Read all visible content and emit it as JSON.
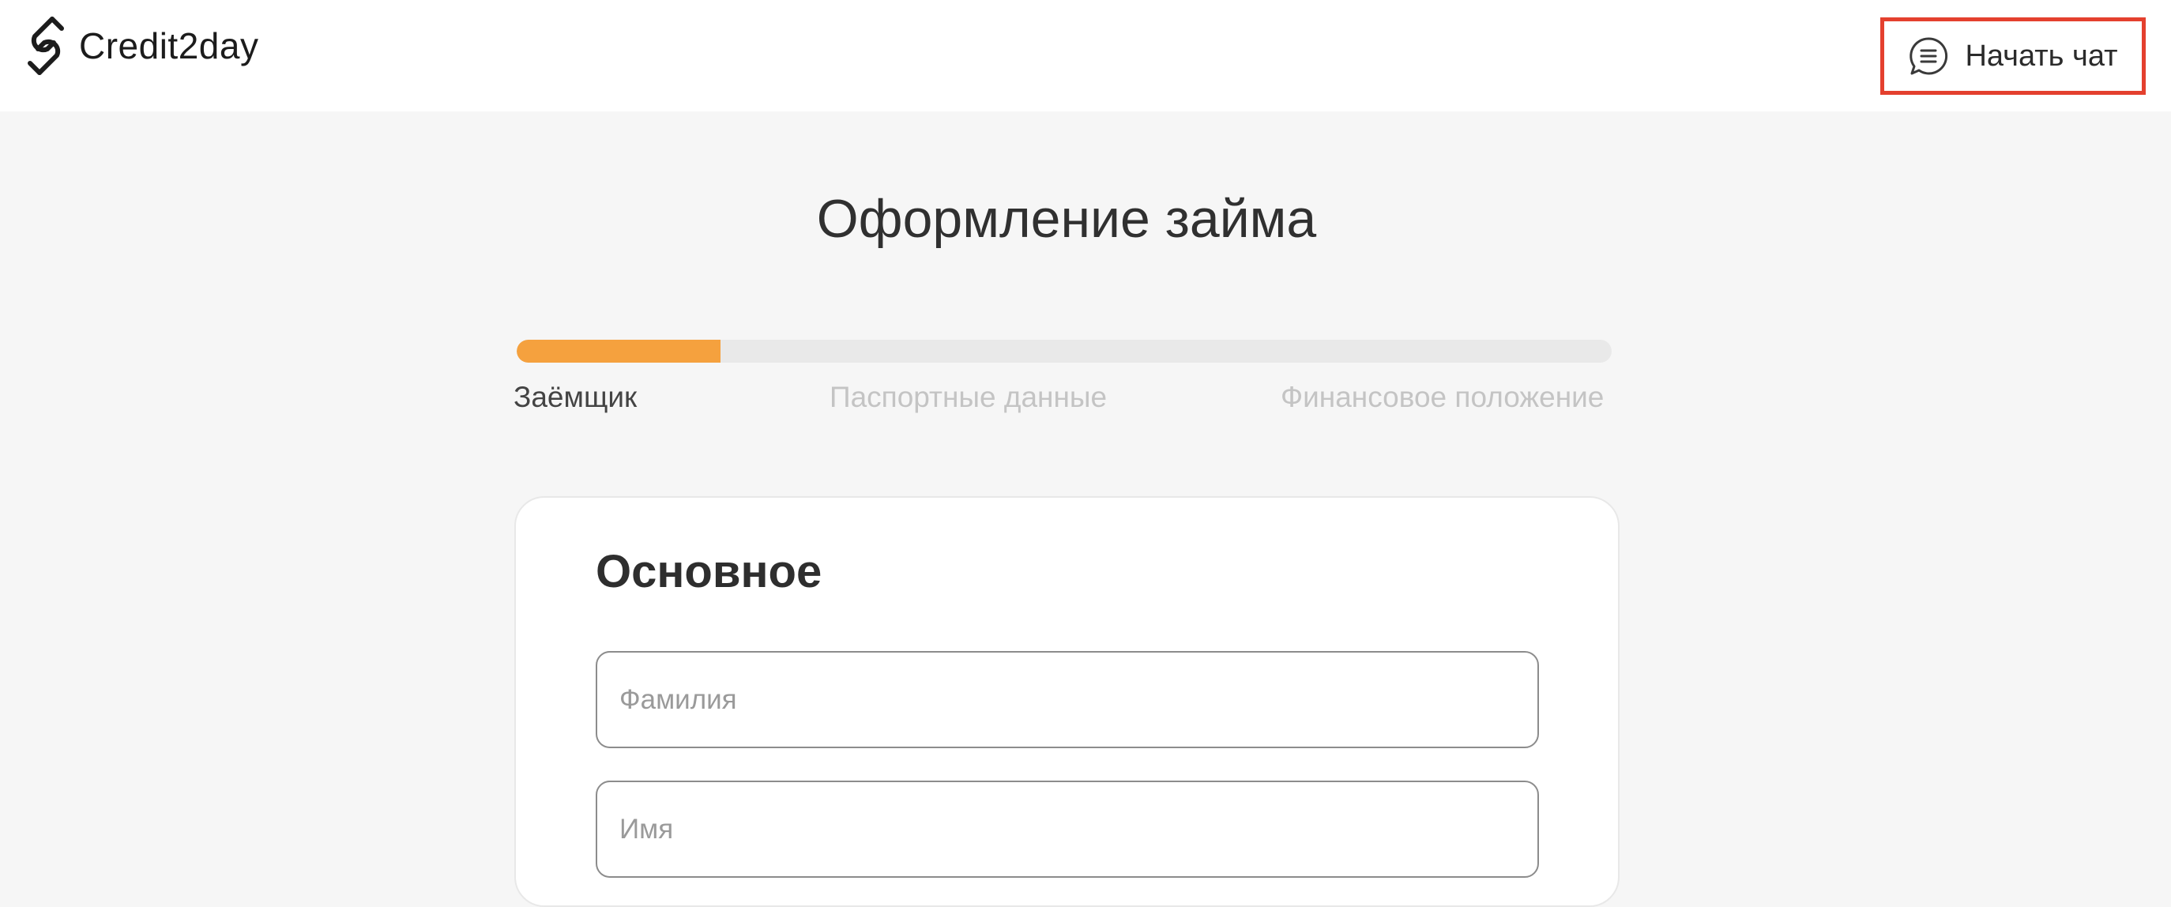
{
  "header": {
    "logo_text": "Credit2day",
    "chat_button_label": "Начать чат"
  },
  "page_title": "Оформление займа",
  "progress": {
    "fraction": 0.186,
    "steps": [
      {
        "label": "Заёмщик",
        "active": true
      },
      {
        "label": "Паспортные данные",
        "active": false
      },
      {
        "label": "Финансовое положение",
        "active": false
      }
    ]
  },
  "form": {
    "section_title": "Основное",
    "fields": {
      "last_name": {
        "placeholder": "Фамилия",
        "value": ""
      },
      "first_name": {
        "placeholder": "Имя",
        "value": ""
      }
    }
  },
  "colors": {
    "accent": "#f5a13e",
    "highlight_border": "#e4402e",
    "background": "#f6f6f6"
  },
  "icons": {
    "logo": "credit2day-logo-icon",
    "chat": "chat-bubble-icon"
  }
}
